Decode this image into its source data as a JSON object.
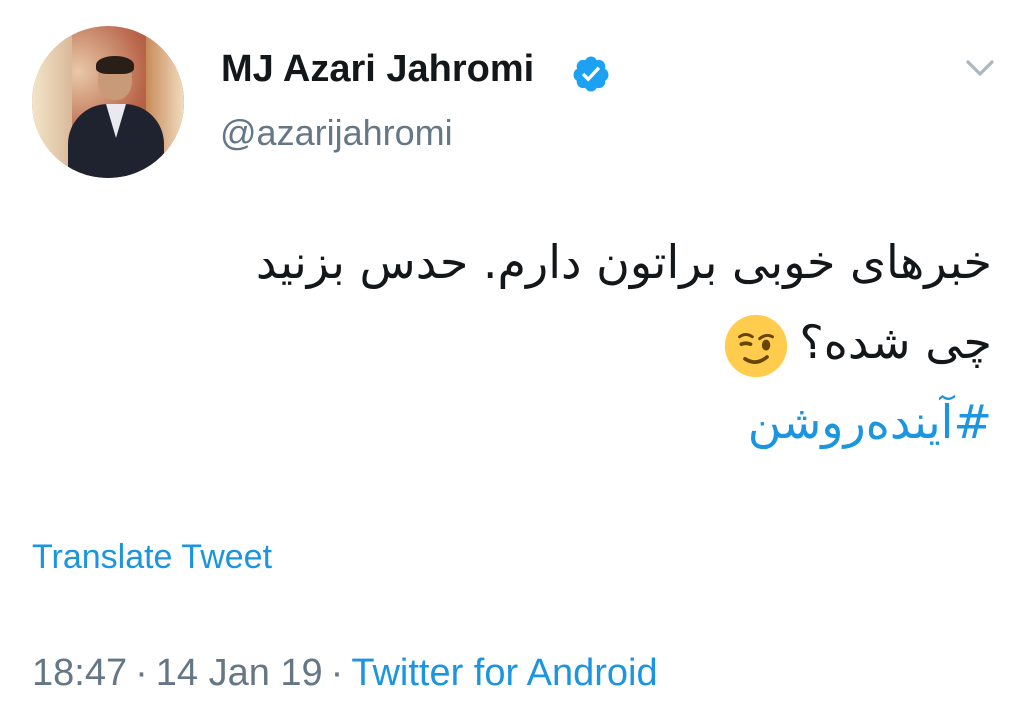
{
  "user": {
    "display_name": "MJ Azari Jahromi",
    "handle": "@azarijahromi",
    "verified": true
  },
  "tweet": {
    "line1": "خبرهای خوبی براتون دارم. حدس بزنید",
    "line2": "چی شده؟",
    "emoji": "winking-face",
    "hashtag": "#آینده‌روشن"
  },
  "actions": {
    "translate_label": "Translate Tweet"
  },
  "meta": {
    "time": "18:47",
    "separator": "·",
    "date": "14 Jan 19",
    "source": "Twitter for Android"
  },
  "colors": {
    "link": "#1b95e0",
    "text": "#14171a",
    "muted": "#657786",
    "verified": "#1da1f2"
  }
}
